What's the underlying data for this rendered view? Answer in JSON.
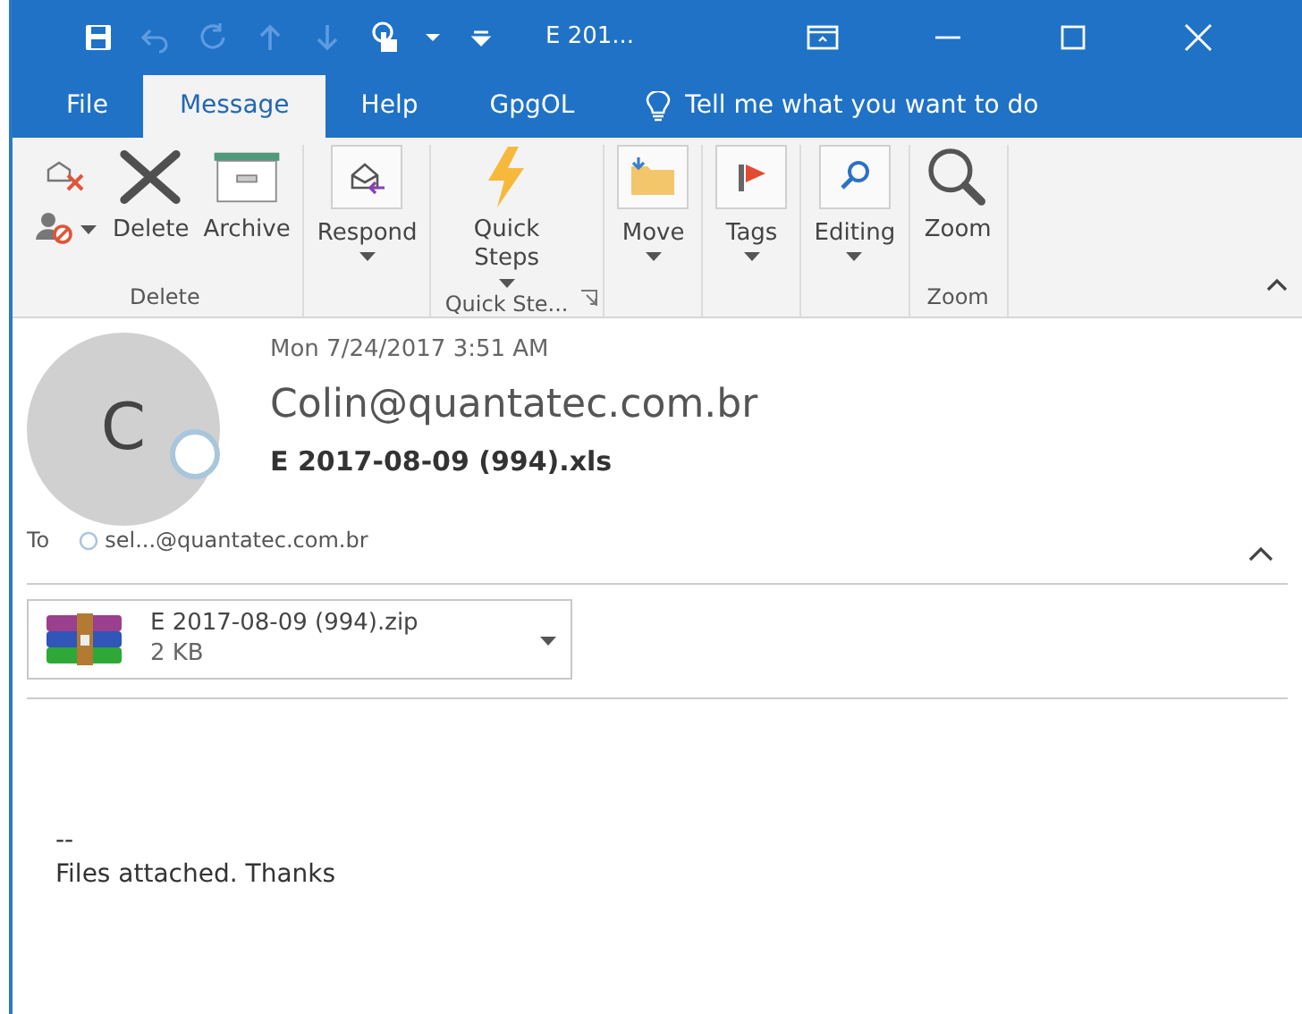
{
  "title_bar": {
    "title": "E 201...",
    "quick_access": [
      {
        "kind": "save",
        "disabled": false
      },
      {
        "kind": "undo",
        "disabled": true
      },
      {
        "kind": "redo",
        "disabled": true
      },
      {
        "kind": "up",
        "disabled": true
      },
      {
        "kind": "down",
        "disabled": true
      },
      {
        "kind": "touch",
        "disabled": false
      },
      {
        "kind": "caret",
        "disabled": false
      },
      {
        "kind": "customize",
        "disabled": false
      }
    ]
  },
  "tabs": [
    {
      "label": "File",
      "selected": false
    },
    {
      "label": "Message",
      "selected": true
    },
    {
      "label": "Help",
      "selected": false
    },
    {
      "label": "GpgOL",
      "selected": false
    }
  ],
  "tell_me": "Tell me what you want to do",
  "ribbon": [
    {
      "label": "Delete",
      "buttons": [
        {
          "kind": "small-stack"
        },
        {
          "kind": "delete",
          "label": "Delete",
          "dropdown": false,
          "boxed": false
        },
        {
          "kind": "archive",
          "label": "Archive",
          "dropdown": false,
          "boxed": false
        }
      ]
    },
    {
      "buttons": [
        {
          "kind": "respond",
          "label": "Respond",
          "dropdown": true,
          "boxed": true
        }
      ]
    },
    {
      "label": "Quick Ste...",
      "launcher": true,
      "buttons": [
        {
          "kind": "quick-steps",
          "label": "Quick Steps",
          "dropdown": true,
          "boxed": false
        }
      ]
    },
    {
      "buttons": [
        {
          "kind": "move",
          "label": "Move",
          "dropdown": true,
          "boxed": true
        }
      ]
    },
    {
      "buttons": [
        {
          "kind": "tags",
          "label": "Tags",
          "dropdown": true,
          "boxed": true
        }
      ]
    },
    {
      "buttons": [
        {
          "kind": "editing",
          "label": "Editing",
          "dropdown": true,
          "boxed": true
        }
      ]
    },
    {
      "label": "Zoom",
      "buttons": [
        {
          "kind": "zoom",
          "label": "Zoom",
          "dropdown": false,
          "boxed": false
        }
      ]
    }
  ],
  "message": {
    "date": "Mon 7/24/2017 3:51 AM",
    "avatar_initial": "C",
    "sender": "Colin@quantatec.com.br",
    "subject": "E 2017-08-09 (994).xls",
    "to_label": "To",
    "recipient": "sel...@quantatec.com.br",
    "attachment": {
      "name": "E 2017-08-09 (994).zip",
      "size": "2 KB"
    },
    "body": [
      "--",
      "Files attached. Thanks"
    ]
  }
}
